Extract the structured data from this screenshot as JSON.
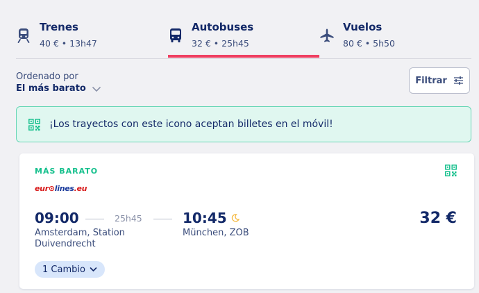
{
  "tabs": [
    {
      "name": "Trenes",
      "meta": "40 € • 13h47",
      "icon": "train-icon",
      "active": false
    },
    {
      "name": "Autobuses",
      "meta": "32 € • 25h45",
      "icon": "bus-icon",
      "active": true
    },
    {
      "name": "Vuelos",
      "meta": "80 € • 5h50",
      "icon": "plane-icon",
      "active": false
    }
  ],
  "sort": {
    "label": "Ordenado por",
    "value": "El más barato"
  },
  "filter": {
    "label": "Filtrar"
  },
  "banner": {
    "text": "¡Los trayectos con este icono aceptan billetes en el móvil!"
  },
  "result": {
    "badge": "MÁS BARATO",
    "operator_logo": "eurolines.eu",
    "departure_time": "09:00",
    "duration": "25h45",
    "arrival_time": "10:45",
    "departure_station_line1": "Amsterdam, Station",
    "departure_station_line2": "Duivendrecht",
    "arrival_station": "München, ZOB",
    "price": "32 €",
    "changes": "1 Cambio"
  },
  "colors": {
    "accent": "#ef3f61",
    "navy": "#132968",
    "green": "#16c08d",
    "banner_bg": "#e0f7f0"
  }
}
